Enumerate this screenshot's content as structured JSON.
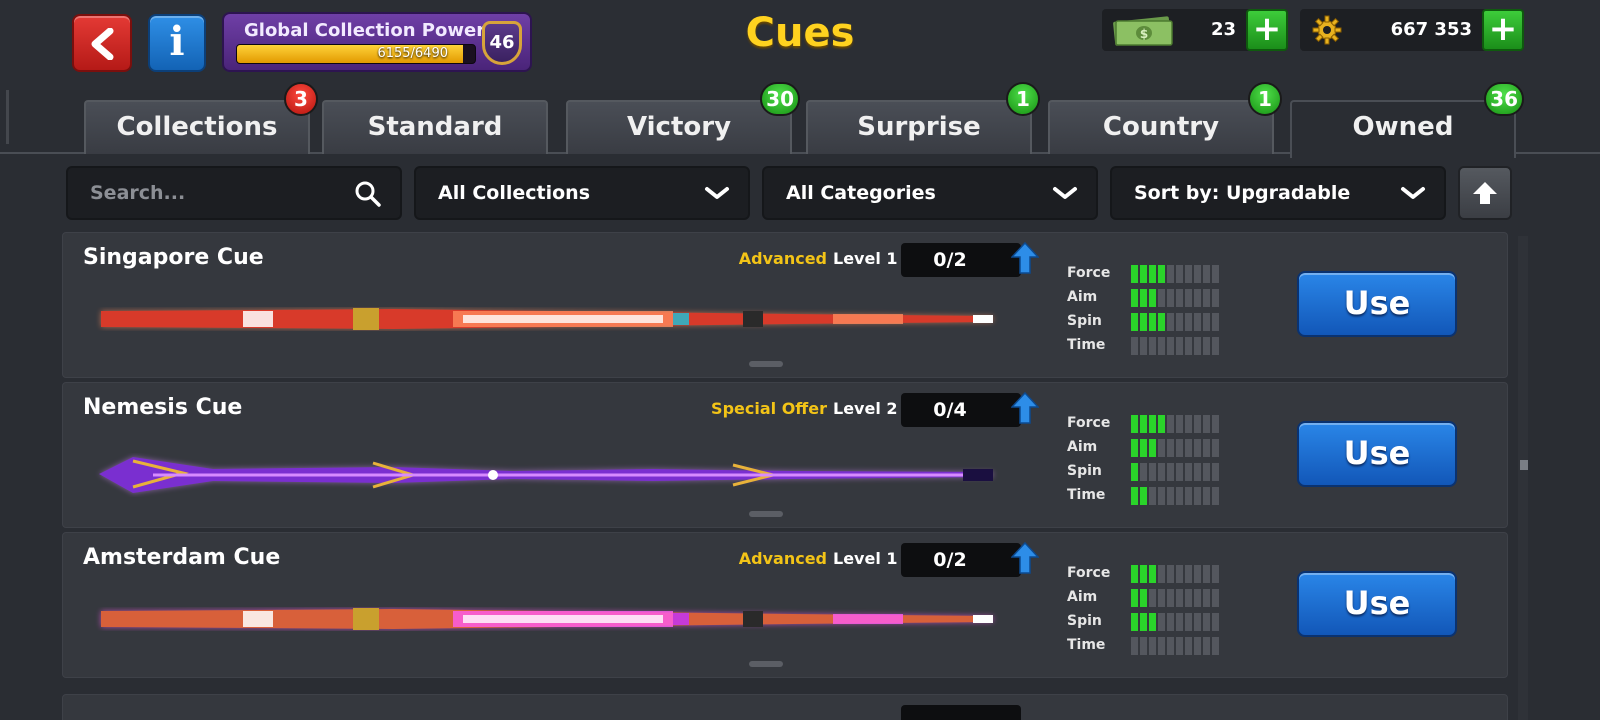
{
  "header": {
    "title": "Cues",
    "power": {
      "label": "Global Collection Power",
      "progress_text": "6155/6490",
      "current": 6155,
      "max": 6490,
      "level": "46"
    },
    "cash": {
      "amount": "23"
    },
    "coins": {
      "amount": "667 353"
    },
    "plus_label": "+"
  },
  "tabs": [
    {
      "label": "Collections",
      "badge": "3",
      "badge_color": "red"
    },
    {
      "label": "Standard",
      "badge": "",
      "badge_color": ""
    },
    {
      "label": "Victory",
      "badge": "30",
      "badge_color": "green"
    },
    {
      "label": "Surprise",
      "badge": "1",
      "badge_color": "green"
    },
    {
      "label": "Country",
      "badge": "1",
      "badge_color": "green"
    },
    {
      "label": "Owned",
      "badge": "36",
      "badge_color": "green",
      "active": true
    }
  ],
  "filters": {
    "search_placeholder": "Search...",
    "collections": "All Collections",
    "categories": "All Categories",
    "sort": "Sort by: Upgradable"
  },
  "stat_labels": {
    "force": "Force",
    "aim": "Aim",
    "spin": "Spin",
    "time": "Time"
  },
  "cues": [
    {
      "name": "Singapore Cue",
      "rarity": "Advanced",
      "level": "Level 1",
      "progress": "0/2",
      "stats": {
        "force": 4,
        "aim": 3,
        "spin": 4,
        "time": 0
      },
      "use_label": "Use",
      "colors": {
        "primary": "#d83a2a",
        "glow": "#ff8a5c",
        "accent": "#3fa8b8"
      }
    },
    {
      "name": "Nemesis Cue",
      "rarity": "Special Offer",
      "level": "Level 2",
      "progress": "0/4",
      "stats": {
        "force": 4,
        "aim": 3,
        "spin": 1,
        "time": 2
      },
      "use_label": "Use",
      "colors": {
        "primary": "#7a2fd0",
        "glow": "#d78bff",
        "accent": "#e8b23a"
      }
    },
    {
      "name": "Amsterdam Cue",
      "rarity": "Advanced",
      "level": "Level 1",
      "progress": "0/2",
      "stats": {
        "force": 3,
        "aim": 2,
        "spin": 3,
        "time": 0
      },
      "use_label": "Use",
      "colors": {
        "primary": "#d8603a",
        "glow": "#ff5cf0",
        "accent": "#c63ad8"
      }
    }
  ],
  "stat_max": 10
}
